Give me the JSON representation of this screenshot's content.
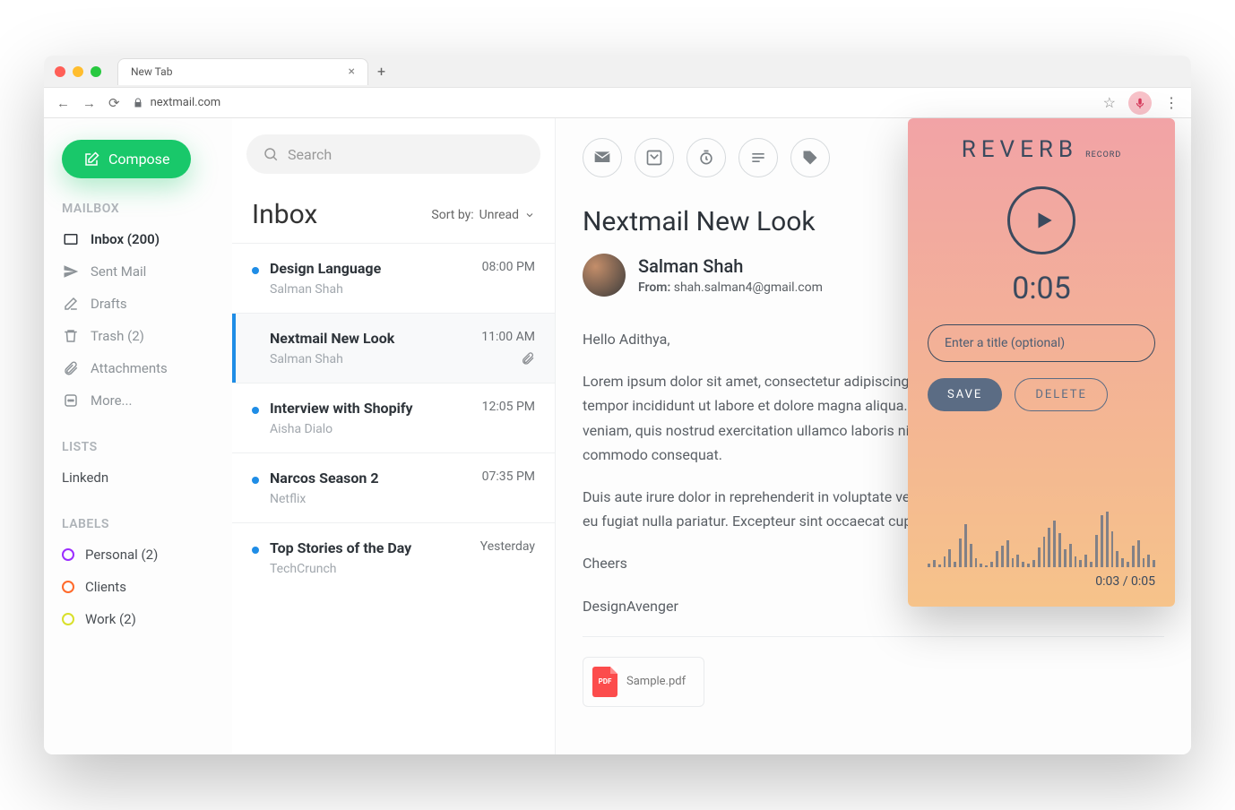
{
  "browser": {
    "tab_title": "New Tab",
    "url": "nextmail.com"
  },
  "sidebar": {
    "compose": "Compose",
    "mailbox_h": "MAILBOX",
    "mailbox": [
      {
        "label": "Inbox (200)"
      },
      {
        "label": "Sent Mail"
      },
      {
        "label": "Drafts"
      },
      {
        "label": "Trash (2)"
      },
      {
        "label": "Attachments"
      },
      {
        "label": "More..."
      }
    ],
    "lists_h": "LISTS",
    "lists": [
      {
        "label": "Linkedn"
      }
    ],
    "labels_h": "LABELS",
    "labels": [
      {
        "label": "Personal (2)",
        "color": "#9b2dff"
      },
      {
        "label": "Clients",
        "color": "#ff6a2b"
      },
      {
        "label": "Work (2)",
        "color": "#d9e02b"
      }
    ]
  },
  "list": {
    "title": "Inbox",
    "search_placeholder": "Search",
    "sort_label": "Sort by:",
    "sort_value": "Unread",
    "items": [
      {
        "subject": "Design Language",
        "from": "Salman Shah",
        "time": "08:00 PM",
        "unread": true
      },
      {
        "subject": "Nextmail New Look",
        "from": "Salman Shah",
        "time": "11:00 AM",
        "unread": false,
        "selected": true,
        "attach": true
      },
      {
        "subject": "Interview with Shopify",
        "from": "Aisha Dialo",
        "time": "12:05 PM",
        "unread": true
      },
      {
        "subject": "Narcos Season 2",
        "from": "Netflix",
        "time": "07:35 PM",
        "unread": true
      },
      {
        "subject": "Top Stories of the Day",
        "from": "TechCrunch",
        "time": "Yesterday",
        "unread": true
      }
    ]
  },
  "reader": {
    "title": "Nextmail New Look",
    "sender_name": "Salman Shah",
    "from_label": "From:",
    "from_email": "shah.salman4@gmail.com",
    "greeting": "Hello Adithya,",
    "p1": "Lorem ipsum dolor sit amet, consectetur adipiscing elit, sed do eiusmod tempor incididunt ut labore et dolore magna aliqua. Ut enim ad minim veniam, quis nostrud exercitation ullamco laboris nisi ut aliquip ex ea commodo consequat.",
    "p2": "Duis aute irure dolor in reprehenderit in voluptate velit esse cillum dolore eu fugiat nulla pariatur. Excepteur sint occaecat cupidatat non proident.",
    "sign1": "Cheers",
    "sign2": "DesignAvenger",
    "attachment": "Sample.pdf",
    "pdf_badge": "PDF"
  },
  "reverb": {
    "brand": "REVERB",
    "brand_sub": "RECORD",
    "time": "0:05",
    "title_placeholder": "Enter a title (optional)",
    "save": "SAVE",
    "delete": "DELETE",
    "progress": "0:03 / 0:05",
    "waveform": [
      4,
      8,
      3,
      12,
      20,
      6,
      32,
      48,
      26,
      10,
      4,
      2,
      6,
      18,
      24,
      30,
      10,
      14,
      6,
      4,
      8,
      22,
      34,
      44,
      52,
      38,
      20,
      26,
      12,
      8,
      14,
      6,
      36,
      58,
      62,
      40,
      18,
      10,
      6,
      24,
      30,
      10,
      14,
      8
    ]
  }
}
